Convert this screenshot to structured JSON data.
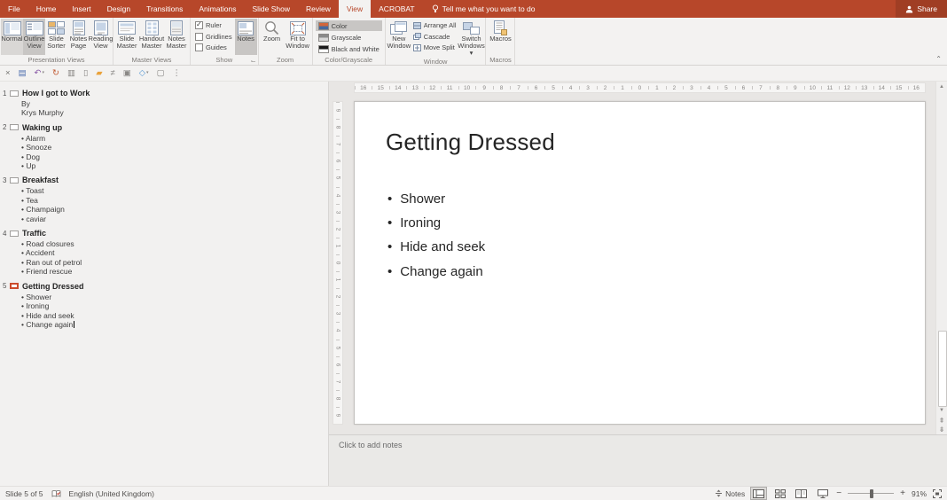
{
  "titlebar": {
    "tabs": [
      {
        "label": "File"
      },
      {
        "label": "Home"
      },
      {
        "label": "Insert"
      },
      {
        "label": "Design"
      },
      {
        "label": "Transitions"
      },
      {
        "label": "Animations"
      },
      {
        "label": "Slide Show"
      },
      {
        "label": "Review"
      },
      {
        "label": "View"
      },
      {
        "label": "ACROBAT"
      }
    ],
    "active_tab": "View",
    "tellme": "Tell me what you want to do",
    "share": "Share"
  },
  "qat": {
    "icons": [
      {
        "name": "close-icon",
        "glyph": "×",
        "color": "#777774"
      },
      {
        "name": "save-icon",
        "glyph": "▤",
        "color": "#4e6fae"
      },
      {
        "name": "undo-icon",
        "glyph": "↶",
        "color": "#8a5ca8",
        "caret": true
      },
      {
        "name": "redo-icon",
        "glyph": "↻",
        "color": "#c25a33"
      },
      {
        "name": "start-slideshow-icon",
        "glyph": "▥",
        "color": "#8a8886"
      },
      {
        "name": "new-file-icon",
        "glyph": "▯",
        "color": "#8a8886"
      },
      {
        "name": "open-folder-icon",
        "glyph": "▰",
        "color": "#e9a23b"
      },
      {
        "name": "pen-icon",
        "glyph": "≠",
        "color": "#8a8886"
      },
      {
        "name": "camera-icon",
        "glyph": "▣",
        "color": "#8a8886"
      },
      {
        "name": "shapes-icon",
        "glyph": "◇",
        "color": "#5b9bd5",
        "caret": true
      },
      {
        "name": "window-icon",
        "glyph": "▢",
        "color": "#8a8886"
      },
      {
        "name": "more-icon",
        "glyph": "⋮",
        "color": "#8a8886"
      }
    ]
  },
  "ribbon": {
    "presentation_views": {
      "label": "Presentation Views",
      "buttons": [
        "Normal",
        "Outline View",
        "Slide Sorter",
        "Notes Page",
        "Reading View"
      ],
      "selected": "Outline View"
    },
    "master_views": {
      "label": "Master Views",
      "buttons": [
        "Slide Master",
        "Handout Master",
        "Notes Master"
      ]
    },
    "show": {
      "label": "Show",
      "checkboxes": [
        {
          "label": "Ruler",
          "checked": true
        },
        {
          "label": "Gridlines",
          "checked": false
        },
        {
          "label": "Guides",
          "checked": false
        }
      ],
      "notes_button": "Notes"
    },
    "zoom": {
      "label": "Zoom",
      "buttons": [
        "Zoom",
        "Fit to Window"
      ]
    },
    "color_grayscale": {
      "label": "Color/Grayscale",
      "items": [
        "Color",
        "Grayscale",
        "Black and White"
      ],
      "selected": "Color"
    },
    "window": {
      "label": "Window",
      "new_window": "New Window",
      "small_buttons": [
        "Arrange All",
        "Cascade",
        "Move Split"
      ],
      "switch_windows": "Switch Windows"
    },
    "macros": {
      "label": "Macros",
      "button": "Macros"
    }
  },
  "outline": {
    "slides": [
      {
        "num": 1,
        "title": "How I got to Work",
        "current": false,
        "lines": [
          {
            "text": "By",
            "bullet": false
          },
          {
            "text": "Krys Murphy",
            "bullet": false
          }
        ]
      },
      {
        "num": 2,
        "title": "Waking up",
        "current": false,
        "lines": [
          {
            "text": "Alarm",
            "bullet": true
          },
          {
            "text": "Snooze",
            "bullet": true
          },
          {
            "text": "Dog",
            "bullet": true
          },
          {
            "text": "Up",
            "bullet": true
          }
        ]
      },
      {
        "num": 3,
        "title": "Breakfast",
        "current": false,
        "lines": [
          {
            "text": "Toast",
            "bullet": true
          },
          {
            "text": "Tea",
            "bullet": true
          },
          {
            "text": "Champaign",
            "bullet": true
          },
          {
            "text": "caviar",
            "bullet": true
          }
        ]
      },
      {
        "num": 4,
        "title": "Traffic",
        "current": false,
        "lines": [
          {
            "text": "Road closures",
            "bullet": true
          },
          {
            "text": "Accident",
            "bullet": true
          },
          {
            "text": "Ran out of petrol",
            "bullet": true
          },
          {
            "text": "Friend rescue",
            "bullet": true
          }
        ]
      },
      {
        "num": 5,
        "title": "Getting Dressed",
        "current": true,
        "caret_after_last": true,
        "lines": [
          {
            "text": "Shower",
            "bullet": true
          },
          {
            "text": "Ironing",
            "bullet": true
          },
          {
            "text": "Hide and seek",
            "bullet": true
          },
          {
            "text": "Change again",
            "bullet": true
          }
        ]
      }
    ]
  },
  "slide": {
    "title": "Getting Dressed",
    "bullets": [
      "Shower",
      "Ironing",
      "Hide and seek",
      "Change again"
    ]
  },
  "rulers": {
    "horizontal": [
      16,
      15,
      14,
      13,
      12,
      11,
      10,
      9,
      8,
      7,
      6,
      5,
      4,
      3,
      2,
      1,
      0,
      1,
      2,
      3,
      4,
      5,
      6,
      7,
      8,
      9,
      10,
      11,
      12,
      13,
      14,
      15,
      16
    ],
    "vertical": [
      9,
      8,
      7,
      6,
      5,
      4,
      3,
      2,
      1,
      0,
      1,
      2,
      3,
      4,
      5,
      6,
      7,
      8,
      9
    ]
  },
  "notes": {
    "placeholder": "Click to add notes"
  },
  "statusbar": {
    "slide_counter": "Slide 5 of 5",
    "language": "English (United Kingdom)",
    "notes_label": "Notes",
    "zoom_percent": "91%"
  },
  "colors": {
    "accent_red": "#b7472a",
    "selected_gray": "#c8c6c4",
    "current_slide_outline": "#cb4b2c"
  }
}
